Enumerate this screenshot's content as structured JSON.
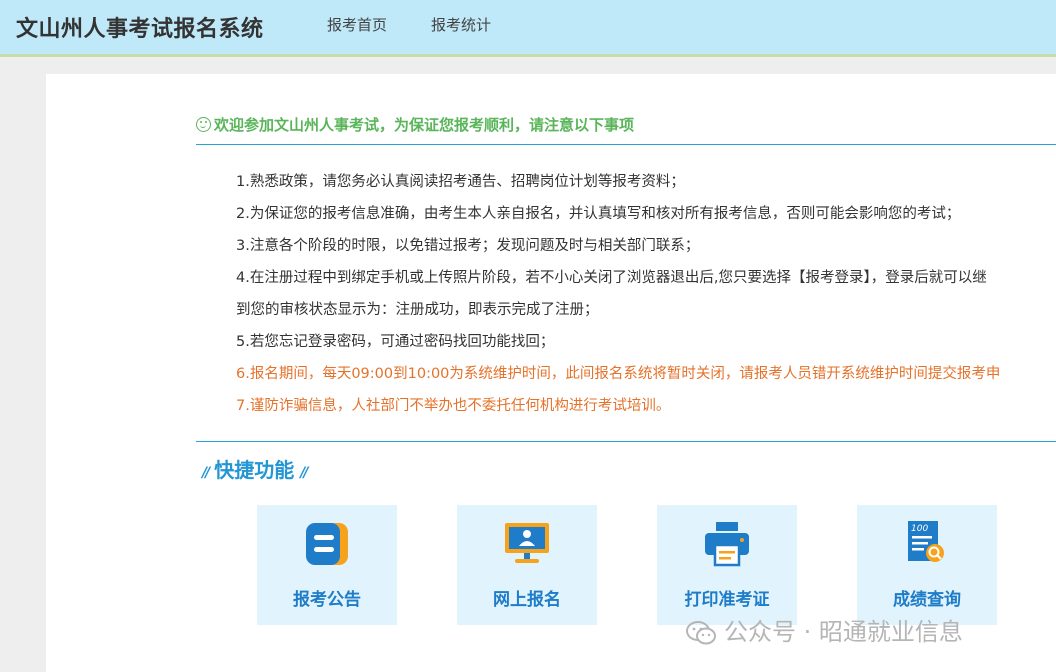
{
  "header": {
    "title": "文山州人事考试报名系统",
    "nav": [
      "报考首页",
      "报考统计"
    ]
  },
  "notice": {
    "title": "欢迎参加文山州人事考试，为保证您报考顺利，请注意以下事项",
    "items": [
      "1.熟悉政策，请您务必认真阅读招考通告、招聘岗位计划等报考资料；",
      "2.为保证您的报考信息准确，由考生本人亲自报名，并认真填写和核对所有报考信息，否则可能会影响您的考试；",
      "3.注意各个阶段的时限，以免错过报考；发现问题及时与相关部门联系；",
      "4.在注册过程中到绑定手机或上传照片阶段，若不小心关闭了浏览器退出后,您只要选择【报考登录】，登录后就可以继",
      "到您的审核状态显示为：注册成功，即表示完成了注册；",
      "5.若您忘记登录密码，可通过密码找回功能找回；",
      "6.报名期间，每天09:00到10:00为系统维护时间，此间报名系统将暂时关闭，请报考人员错开系统维护时间提交报考申",
      "7.谨防诈骗信息，人社部门不举办也不委托任何机构进行考试培训。"
    ]
  },
  "quick": {
    "title": "快捷功能",
    "slash": "//",
    "cards": [
      {
        "label": "报考公告",
        "icon": "announcement-icon"
      },
      {
        "label": "网上报名",
        "icon": "online-register-icon"
      },
      {
        "label": "打印准考证",
        "icon": "printer-icon"
      },
      {
        "label": "成绩查询",
        "icon": "score-query-icon"
      }
    ]
  },
  "watermark": "公众号 · 昭通就业信息",
  "colors": {
    "header_bg": "#bfe8f8",
    "accent_blue": "#2496d3",
    "card_label": "#1e7cc8",
    "notice_green": "#5ab55a",
    "warning_orange": "#e5722a",
    "icon_orange": "#f7a21b"
  }
}
